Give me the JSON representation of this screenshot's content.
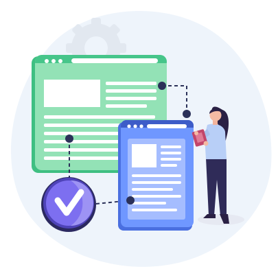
{
  "illustration": {
    "subject": "document-approval-workflow",
    "icons": [
      "gear-icon",
      "checkmark-badge-icon",
      "browser-window-icon",
      "document-page-icon",
      "person-holding-clipboard"
    ],
    "colors": {
      "background_blob": "#eef4fb",
      "gear": "#e1e8f0",
      "window_green": "#8fe0b4",
      "window_green_dark": "#3fbf82",
      "window_blue": "#6f97ff",
      "window_blue_dark": "#4a6fe0",
      "badge_purple": "#7d6ff0",
      "badge_purple_dark": "#4d3fb6",
      "connector_navy": "#2b3159",
      "person_shirt": "#b8cff7",
      "person_pants": "#2f2b58",
      "clipboard": "#c2456a"
    }
  }
}
